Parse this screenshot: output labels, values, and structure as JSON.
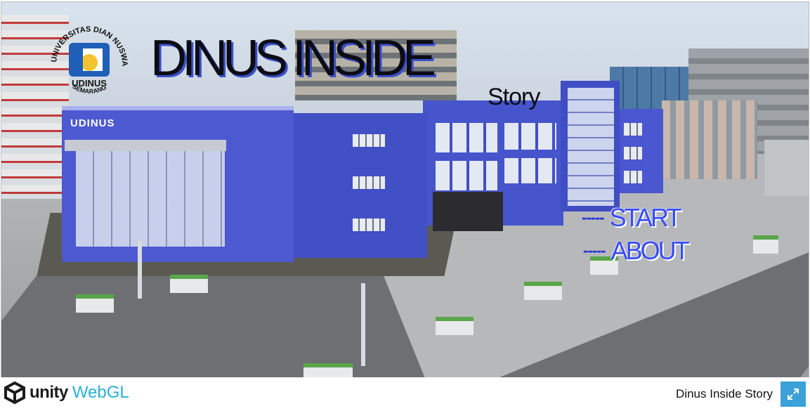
{
  "game": {
    "title_main": "DINUS INSIDE",
    "title_sub": "Story",
    "logo": {
      "ring_text": "UNIVERSITAS DIAN NUSWANTORO",
      "ring_bottom": "SEMARANG",
      "brand": "UDINUS"
    },
    "building_sign": "UDINUS",
    "menu": [
      {
        "dash": "-----",
        "label": "START"
      },
      {
        "dash": "-----",
        "label": "ABOUT"
      }
    ],
    "colors": {
      "title_shadow": "#3b50c8",
      "menu_text": "#3a4df0",
      "building": "#4d59d0"
    }
  },
  "footer": {
    "engine_word": "unity",
    "platform_word": "WebGL",
    "game_name": "Dinus Inside Story",
    "fullscreen_icon": "expand-icon",
    "fullscreen_color": "#3aa1d9"
  }
}
